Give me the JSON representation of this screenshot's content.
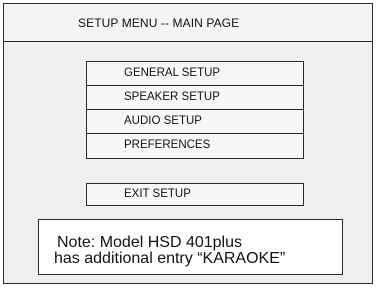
{
  "header": {
    "title": "SETUP MENU   -- MAIN PAGE"
  },
  "menu": {
    "items": [
      {
        "label": "GENERAL SETUP"
      },
      {
        "label": "SPEAKER SETUP"
      },
      {
        "label": "AUDIO SETUP"
      },
      {
        "label": "PREFERENCES"
      }
    ],
    "exit_label": "EXIT SETUP"
  },
  "note": {
    "line1": "Note: Model HSD 401plus",
    "line2": "has additional entry “KARAOKE”"
  }
}
